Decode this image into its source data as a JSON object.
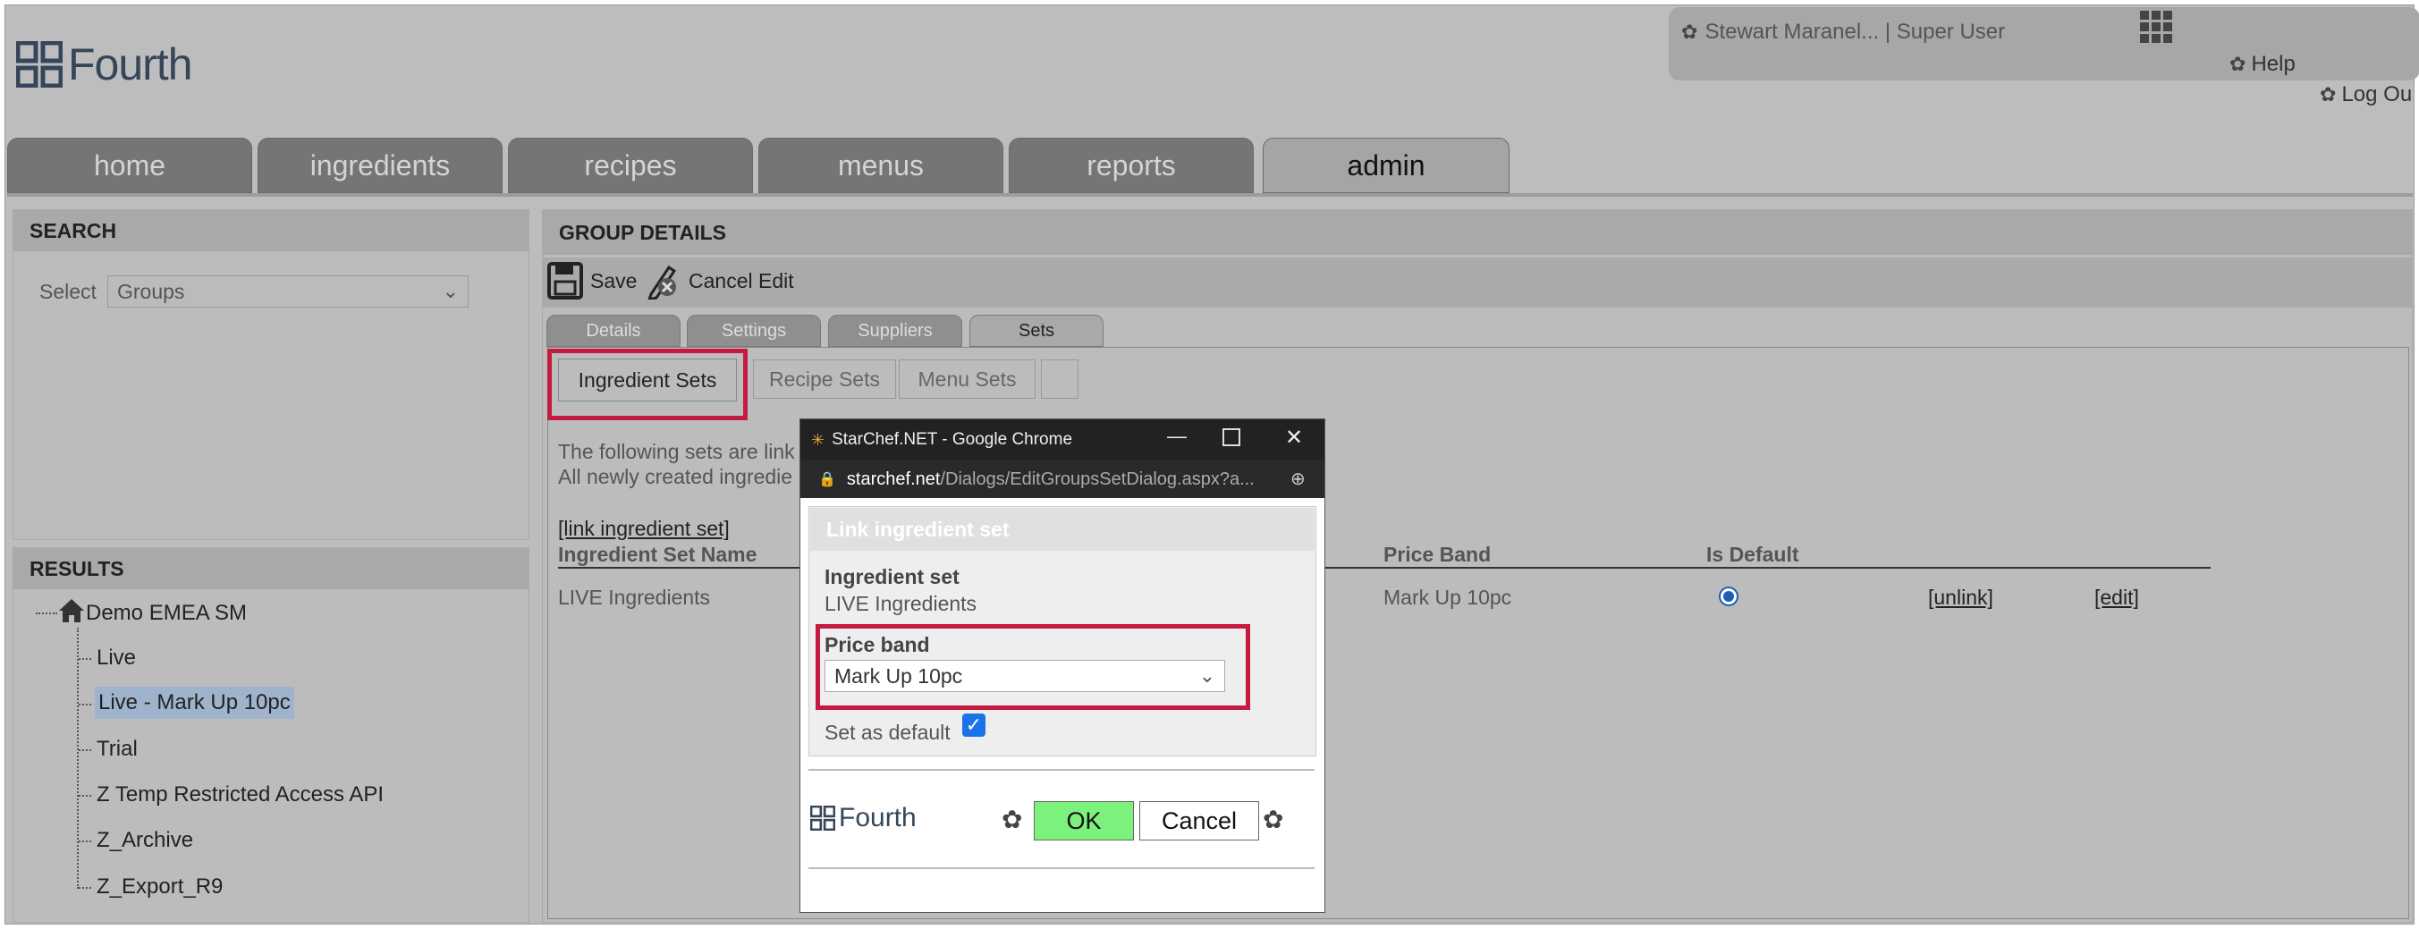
{
  "header": {
    "logo_text": "Fourth",
    "user": "Stewart Maranel... | Super User",
    "help": "Help",
    "logout": "Log Ou"
  },
  "main_tabs": [
    {
      "label": "home"
    },
    {
      "label": "ingredients"
    },
    {
      "label": "recipes"
    },
    {
      "label": "menus"
    },
    {
      "label": "reports"
    },
    {
      "label": "admin",
      "active": true
    }
  ],
  "search": {
    "title": "SEARCH",
    "select_label": "Select",
    "select_value": "Groups"
  },
  "results": {
    "title": "RESULTS",
    "root": "Demo EMEA SM",
    "items": [
      "Live",
      "Live - Mark Up 10pc",
      "Trial",
      "Z Temp Restricted Access API",
      "Z_Archive",
      "Z_Export_R9"
    ],
    "selected": "Live - Mark Up 10pc"
  },
  "group_details": {
    "title": "GROUP DETAILS",
    "save": "Save",
    "cancel_edit": "Cancel Edit",
    "sub_tabs": [
      "Details",
      "Settings",
      "Suppliers",
      "Sets"
    ],
    "active_sub_tab": "Sets",
    "set_tabs": [
      "Ingredient Sets",
      "Recipe Sets",
      "Menu Sets",
      ""
    ],
    "info_line1": "The following sets are link",
    "info_line2": "All newly created ingredie",
    "link_action": "[link ingredient set]",
    "columns": {
      "name": "Ingredient Set Name",
      "price_band": "Price Band",
      "is_default": "Is Default"
    },
    "rows": [
      {
        "name": "LIVE Ingredients",
        "price_band": "Mark Up 10pc",
        "is_default": true,
        "unlink": "[unlink]",
        "edit": "[edit]"
      }
    ]
  },
  "dialog": {
    "window_title": "StarChef.NET - Google Chrome",
    "url_domain": "starchef.net",
    "url_path": "/Dialogs/EditGroupsSetDialog.aspx?a...",
    "heading": "Link ingredient set",
    "ingredient_set_label": "Ingredient set",
    "ingredient_set_value": "LIVE Ingredients",
    "price_band_label": "Price band",
    "price_band_value": "Mark Up 10pc",
    "set_default_label": "Set as default",
    "set_default_checked": true,
    "footer_logo": "Fourth",
    "ok": "OK",
    "cancel": "Cancel"
  },
  "colors": {
    "highlight_red": "#c51a3f",
    "ok_green": "#7cf27c",
    "selected_item": "#9fb4cc"
  }
}
